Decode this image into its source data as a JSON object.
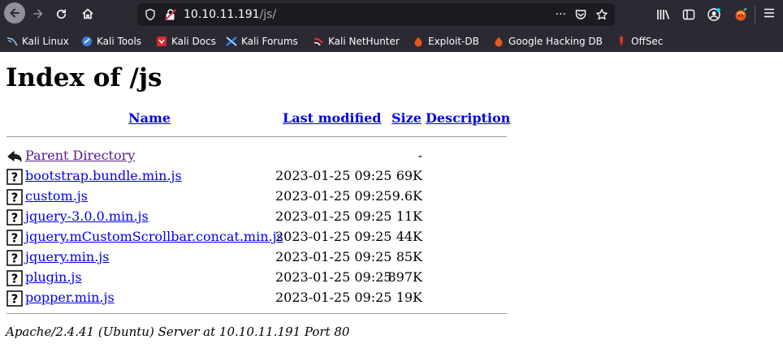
{
  "browser": {
    "url_host": "10.10.11.191",
    "url_path": "/js/",
    "url_more": "···",
    "nav_icons": [
      "back-arrow-icon",
      "forward-arrow-icon",
      "reload-icon",
      "home-icon"
    ],
    "url_icons": [
      "page-info-icon",
      "insecure-lock-icon",
      "pocket-icon",
      "bookmark-star-icon"
    ],
    "toolbar_icons": [
      "library-icon",
      "sidebar-icon",
      "account-icon",
      "extension-icon",
      "menu-icon"
    ]
  },
  "bookmarks": [
    {
      "label": "Kali Linux",
      "icon": "kali-linux-icon",
      "color": "#5aa0e0"
    },
    {
      "label": "Kali Tools",
      "icon": "kali-tools-icon",
      "color": "#3d7fdc"
    },
    {
      "label": "Kali Docs",
      "icon": "kali-docs-icon",
      "color": "#d42a2a"
    },
    {
      "label": "Kali Forums",
      "icon": "kali-forums-icon",
      "color": "#2f7fe6"
    },
    {
      "label": "Kali NetHunter",
      "icon": "kali-nethunter-icon",
      "color": "#e0301e"
    },
    {
      "label": "Exploit-DB",
      "icon": "exploit-db-icon",
      "color": "#e8561c"
    },
    {
      "label": "Google Hacking DB",
      "icon": "google-hacking-db-icon",
      "color": "#e8561c"
    },
    {
      "label": "OffSec",
      "icon": "offsec-icon",
      "color": "#e0301e"
    }
  ],
  "page": {
    "title": "Index of /js",
    "columns": {
      "name": "Name",
      "last_modified": "Last modified",
      "size": "Size",
      "description": "Description"
    },
    "parent": {
      "name": "Parent Directory",
      "size": "-"
    },
    "files": [
      {
        "name": "bootstrap.bundle.min.js",
        "modified": "2023-01-25 09:25",
        "size": "69K"
      },
      {
        "name": "custom.js",
        "modified": "2023-01-25 09:25",
        "size": "9.6K"
      },
      {
        "name": "jquery-3.0.0.min.js",
        "modified": "2023-01-25 09:25",
        "size": "11K"
      },
      {
        "name": "jquery.mCustomScrollbar.concat.min.js",
        "modified": "2023-01-25 09:25",
        "size": "44K"
      },
      {
        "name": "jquery.min.js",
        "modified": "2023-01-25 09:25",
        "size": "85K"
      },
      {
        "name": "plugin.js",
        "modified": "2023-01-25 09:25",
        "size": "897K"
      },
      {
        "name": "popper.min.js",
        "modified": "2023-01-25 09:25",
        "size": "19K"
      }
    ],
    "footer": "Apache/2.4.41 (Ubuntu) Server at 10.10.11.191 Port 80"
  }
}
